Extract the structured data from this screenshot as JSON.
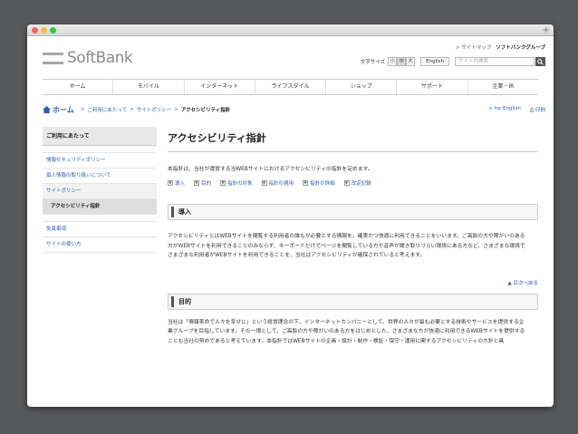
{
  "window": {
    "plus": "+"
  },
  "header": {
    "logo_text": "SoftBank",
    "toplinks": {
      "sitemap": "> サイトマップ",
      "group": "ソフトバンクグループ"
    },
    "fontsize_label": "文字サイズ",
    "fontsize_options": [
      "小",
      "中",
      "大"
    ],
    "english_button": "English",
    "search_placeholder": "サイト内検索"
  },
  "global_nav": [
    "ホーム",
    "モバイル",
    "インターネット",
    "ライフスタイル",
    "ショップ",
    "サポート",
    "企業・IR"
  ],
  "breadcrumb": {
    "home": "ホーム",
    "sep": ">",
    "items": [
      "ご利用にあたって",
      "サイトポリシー"
    ],
    "current": "アクセシビリティ指針",
    "for_english": "> for English",
    "print": "印刷"
  },
  "sidebar": {
    "heading": "ご利用にあたって",
    "items": [
      "情報セキュリティポリシー",
      "個人情報の取り扱いについて",
      "サイトポリシー",
      "アクセシビリティ指針",
      "免責事項",
      "サイトの使い方"
    ]
  },
  "main": {
    "title": "アクセシビリティ指針",
    "lead": "本指針は、当社が運営する当WEBサイトにおけるアクセシビリティの指針を定めます。",
    "anchors": [
      "導入",
      "目的",
      "指針の対象",
      "指針の適用",
      "指針の詳細",
      "改定記録"
    ],
    "section1_title": "導入",
    "section1_body": "アクセシビリティとはWEBサイトを閲覧する利用者の誰もが必要とする情報を、確実かつ快適に利用できることをいいます。ご高齢の方や障がいのある方がWEBサイトを利用できることのみならず、キーボードだけでページを閲覧している方や音声が聞き取りづらい環境にある方など、さまざまな環境でさまざまな利用者がWEBサイトを利用できることを、当社はアクセシビリティが確保されていると考えます。",
    "back_to_top": "目次へ戻る",
    "section2_title": "目的",
    "section2_body": "当社は「情報革命で人々を幸せに」という経営理念の下、インターネットカンパニーとして、世界の人々が最も必要とする技術やサービスを提供する企業グループを目指しています。その一環として、ご高齢の方や障がいのある方をはじめとした、さまざまな方が快適に利用できるWEBサイトを提供することも当社の努めであると考えています。本指針ではWEBサイトの企画・設計・制作・検証・保守・運用に関するアクセシビリティの方針と具"
  }
}
